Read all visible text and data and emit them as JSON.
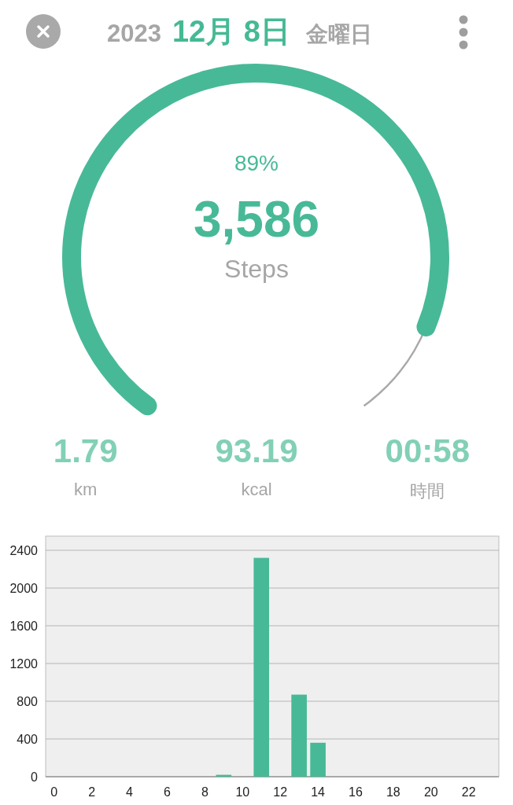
{
  "header": {
    "year": "2023",
    "date": "12月 8日",
    "weekday": "金曜日"
  },
  "gauge": {
    "percent": "89%",
    "value": "3,586",
    "unit": "Steps"
  },
  "stats": [
    {
      "value": "1.79",
      "label": "km"
    },
    {
      "value": "93.19",
      "label": "kcal"
    },
    {
      "value": "00:58",
      "label": "時間"
    }
  ],
  "chart": {
    "chart_data": {
      "type": "bar",
      "x": [
        9,
        11,
        13,
        14
      ],
      "values": [
        20,
        2320,
        870,
        360
      ],
      "ylim": [
        0,
        2550
      ],
      "grid": true,
      "xlim": [
        -0.45,
        23.6
      ],
      "xticks": [
        0,
        2,
        4,
        6,
        8,
        10,
        12,
        14,
        16,
        18,
        20,
        22
      ],
      "yticks": [
        0,
        400,
        800,
        1200,
        1600,
        2000,
        2400
      ]
    }
  }
}
